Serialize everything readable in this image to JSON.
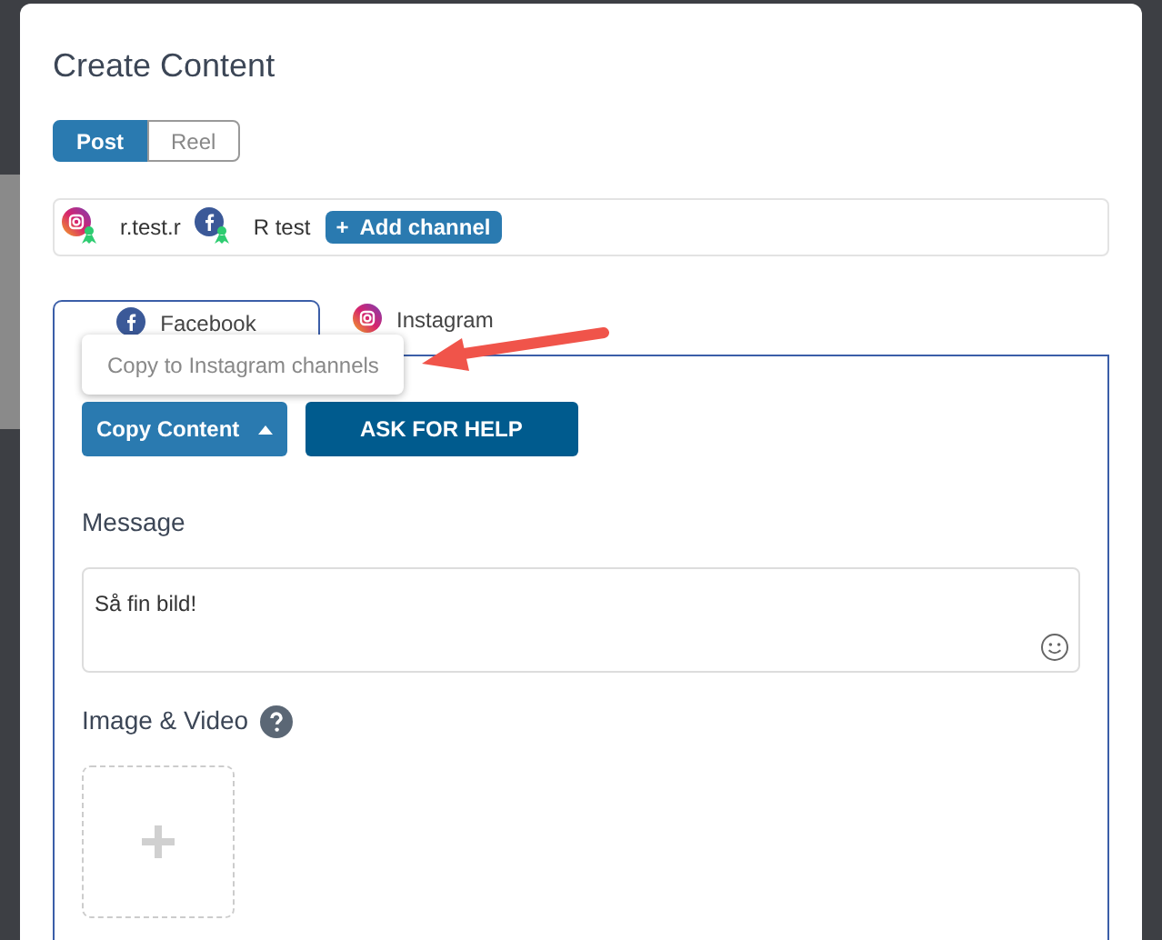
{
  "dialog": {
    "title": "Create Content"
  },
  "format_toggle": [
    {
      "label": "Post",
      "selected": true
    },
    {
      "label": "Reel",
      "selected": false
    }
  ],
  "channels": [
    {
      "kind": "instagram",
      "name": "r.test.r"
    },
    {
      "kind": "facebook",
      "name": "R test"
    }
  ],
  "add_channel": {
    "icon": "+",
    "label": "Add channel"
  },
  "tabs": [
    {
      "kind": "facebook",
      "label": "Facebook",
      "selected": true
    },
    {
      "kind": "instagram",
      "label": "Instagram",
      "selected": false
    }
  ],
  "tooltip": "Copy to Instagram channels",
  "copy_button": {
    "label": "Copy Content",
    "expanded": true
  },
  "help_button": "ASK FOR HELP",
  "message": {
    "label": "Message",
    "value": "Så fin bild!"
  },
  "media": {
    "label": "Image & Video"
  }
}
